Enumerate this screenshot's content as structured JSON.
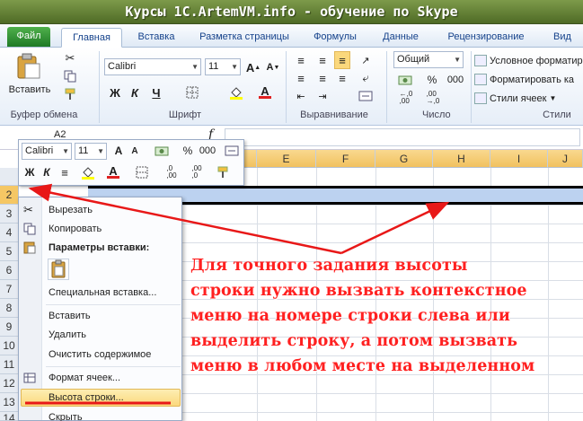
{
  "window": {
    "title": "Курсы 1C.ArtemVM.info - обучение по Skype"
  },
  "tabs": [
    "Файл",
    "Главная",
    "Вставка",
    "Разметка страницы",
    "Формулы",
    "Данные",
    "Рецензирование",
    "Вид"
  ],
  "ribbon": {
    "clipboard": {
      "paste": "Вставить",
      "group": "Буфер обмена"
    },
    "font": {
      "name": "Calibri",
      "size": "11",
      "bold": "Ж",
      "italic": "К",
      "underline": "Ч",
      "group": "Шрифт"
    },
    "alignment": {
      "group": "Выравнивание"
    },
    "number": {
      "format": "Общий",
      "percent": "%",
      "thousands": "000",
      "group": "Число"
    },
    "styles": {
      "conditional": "Условное форматир",
      "table": "Форматировать ка",
      "cell": "Стили ячеек",
      "group": "Стили"
    }
  },
  "formula_bar": {
    "cell_ref": "A2",
    "fx": "f"
  },
  "columns": [
    "E",
    "F",
    "G",
    "H",
    "I",
    "J"
  ],
  "rows": [
    "2",
    "3",
    "4",
    "5",
    "6",
    "7",
    "8",
    "9",
    "10",
    "11",
    "12",
    "13",
    "14"
  ],
  "mini_toolbar": {
    "font": "Calibri",
    "size": "11",
    "bold": "Ж",
    "italic": "К",
    "percent": "%",
    "thousands": "000"
  },
  "context_menu": {
    "cut": "Вырезать",
    "copy": "Копировать",
    "paste_options": "Параметры вставки:",
    "paste_special": "Специальная вставка...",
    "insert": "Вставить",
    "delete": "Удалить",
    "clear": "Очистить содержимое",
    "format_cells": "Формат ячеек...",
    "row_height": "Высота строки...",
    "hide": "Скрыть"
  },
  "annotation": [
    "Для точного задания высоты",
    "строки нужно вызвать контекстное",
    "меню на номере строки слева или",
    "выделить строку, а потом вызвать",
    "меню в любом месте на выделенном"
  ],
  "colors": {
    "annotation": "#ff2020",
    "title_bar": "#5f7d32",
    "file_tab": "#2e8b34",
    "selection": "#bcd2f0",
    "menu_highlight": "#fbd87c"
  }
}
